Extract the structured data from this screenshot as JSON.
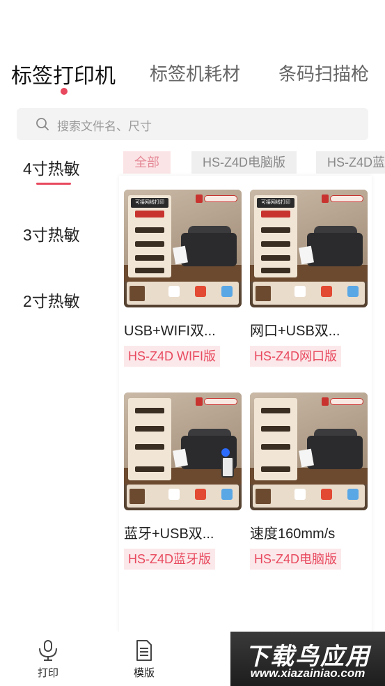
{
  "top_tabs": [
    "标签打印机",
    "标签机耗材",
    "条码扫描枪"
  ],
  "search": {
    "placeholder": "搜索文件名、尺寸"
  },
  "sidebar": {
    "items": [
      "4寸热敏",
      "3寸热敏",
      "2寸热敏"
    ]
  },
  "filters": [
    "全部",
    "HS-Z4D电脑版",
    "HS-Z4D蓝"
  ],
  "products": [
    {
      "title": "USB+WIFI双...",
      "tag": "HS-Z4D WIFI版",
      "panel_title": "可接网线打印",
      "variant": "wifi"
    },
    {
      "title": "网口+USB双...",
      "tag": "HS-Z4D网口版",
      "panel_title": "可接网线打印",
      "variant": "net"
    },
    {
      "title": "蓝牙+USB双...",
      "tag": "HS-Z4D蓝牙版",
      "panel_title": "",
      "variant": "bluetooth"
    },
    {
      "title": "速度160mm/s",
      "tag": "HS-Z4D电脑版",
      "panel_title": "",
      "variant": "pc"
    }
  ],
  "bottom_nav": [
    {
      "label": "打印",
      "icon": "printer-mic-icon"
    },
    {
      "label": "模版",
      "icon": "document-icon"
    }
  ],
  "watermark": {
    "main": "下载鸟应用",
    "sub": "www.xiazainiao.com"
  },
  "colors": {
    "accent": "#e8495e",
    "tag_bg": "#fbe8ea",
    "search_bg": "#f3f3f3"
  }
}
